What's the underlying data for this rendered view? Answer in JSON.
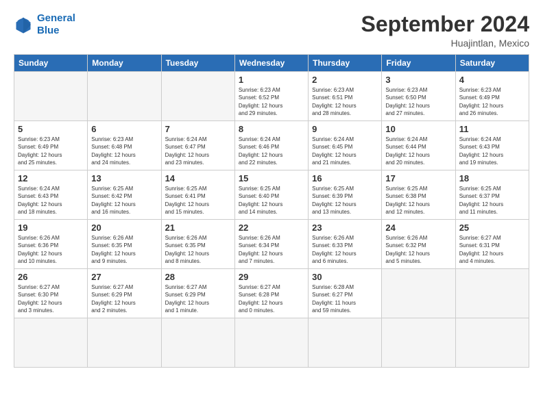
{
  "header": {
    "logo_line1": "General",
    "logo_line2": "Blue",
    "month": "September 2024",
    "location": "Huajintlan, Mexico"
  },
  "weekdays": [
    "Sunday",
    "Monday",
    "Tuesday",
    "Wednesday",
    "Thursday",
    "Friday",
    "Saturday"
  ],
  "days": [
    {
      "num": "",
      "info": ""
    },
    {
      "num": "",
      "info": ""
    },
    {
      "num": "",
      "info": ""
    },
    {
      "num": "1",
      "info": "Sunrise: 6:23 AM\nSunset: 6:52 PM\nDaylight: 12 hours\nand 29 minutes."
    },
    {
      "num": "2",
      "info": "Sunrise: 6:23 AM\nSunset: 6:51 PM\nDaylight: 12 hours\nand 28 minutes."
    },
    {
      "num": "3",
      "info": "Sunrise: 6:23 AM\nSunset: 6:50 PM\nDaylight: 12 hours\nand 27 minutes."
    },
    {
      "num": "4",
      "info": "Sunrise: 6:23 AM\nSunset: 6:49 PM\nDaylight: 12 hours\nand 26 minutes."
    },
    {
      "num": "5",
      "info": "Sunrise: 6:23 AM\nSunset: 6:49 PM\nDaylight: 12 hours\nand 25 minutes."
    },
    {
      "num": "6",
      "info": "Sunrise: 6:23 AM\nSunset: 6:48 PM\nDaylight: 12 hours\nand 24 minutes."
    },
    {
      "num": "7",
      "info": "Sunrise: 6:24 AM\nSunset: 6:47 PM\nDaylight: 12 hours\nand 23 minutes."
    },
    {
      "num": "8",
      "info": "Sunrise: 6:24 AM\nSunset: 6:46 PM\nDaylight: 12 hours\nand 22 minutes."
    },
    {
      "num": "9",
      "info": "Sunrise: 6:24 AM\nSunset: 6:45 PM\nDaylight: 12 hours\nand 21 minutes."
    },
    {
      "num": "10",
      "info": "Sunrise: 6:24 AM\nSunset: 6:44 PM\nDaylight: 12 hours\nand 20 minutes."
    },
    {
      "num": "11",
      "info": "Sunrise: 6:24 AM\nSunset: 6:43 PM\nDaylight: 12 hours\nand 19 minutes."
    },
    {
      "num": "12",
      "info": "Sunrise: 6:24 AM\nSunset: 6:43 PM\nDaylight: 12 hours\nand 18 minutes."
    },
    {
      "num": "13",
      "info": "Sunrise: 6:25 AM\nSunset: 6:42 PM\nDaylight: 12 hours\nand 16 minutes."
    },
    {
      "num": "14",
      "info": "Sunrise: 6:25 AM\nSunset: 6:41 PM\nDaylight: 12 hours\nand 15 minutes."
    },
    {
      "num": "15",
      "info": "Sunrise: 6:25 AM\nSunset: 6:40 PM\nDaylight: 12 hours\nand 14 minutes."
    },
    {
      "num": "16",
      "info": "Sunrise: 6:25 AM\nSunset: 6:39 PM\nDaylight: 12 hours\nand 13 minutes."
    },
    {
      "num": "17",
      "info": "Sunrise: 6:25 AM\nSunset: 6:38 PM\nDaylight: 12 hours\nand 12 minutes."
    },
    {
      "num": "18",
      "info": "Sunrise: 6:25 AM\nSunset: 6:37 PM\nDaylight: 12 hours\nand 11 minutes."
    },
    {
      "num": "19",
      "info": "Sunrise: 6:26 AM\nSunset: 6:36 PM\nDaylight: 12 hours\nand 10 minutes."
    },
    {
      "num": "20",
      "info": "Sunrise: 6:26 AM\nSunset: 6:35 PM\nDaylight: 12 hours\nand 9 minutes."
    },
    {
      "num": "21",
      "info": "Sunrise: 6:26 AM\nSunset: 6:35 PM\nDaylight: 12 hours\nand 8 minutes."
    },
    {
      "num": "22",
      "info": "Sunrise: 6:26 AM\nSunset: 6:34 PM\nDaylight: 12 hours\nand 7 minutes."
    },
    {
      "num": "23",
      "info": "Sunrise: 6:26 AM\nSunset: 6:33 PM\nDaylight: 12 hours\nand 6 minutes."
    },
    {
      "num": "24",
      "info": "Sunrise: 6:26 AM\nSunset: 6:32 PM\nDaylight: 12 hours\nand 5 minutes."
    },
    {
      "num": "25",
      "info": "Sunrise: 6:27 AM\nSunset: 6:31 PM\nDaylight: 12 hours\nand 4 minutes."
    },
    {
      "num": "26",
      "info": "Sunrise: 6:27 AM\nSunset: 6:30 PM\nDaylight: 12 hours\nand 3 minutes."
    },
    {
      "num": "27",
      "info": "Sunrise: 6:27 AM\nSunset: 6:29 PM\nDaylight: 12 hours\nand 2 minutes."
    },
    {
      "num": "28",
      "info": "Sunrise: 6:27 AM\nSunset: 6:29 PM\nDaylight: 12 hours\nand 1 minute."
    },
    {
      "num": "29",
      "info": "Sunrise: 6:27 AM\nSunset: 6:28 PM\nDaylight: 12 hours\nand 0 minutes."
    },
    {
      "num": "30",
      "info": "Sunrise: 6:28 AM\nSunset: 6:27 PM\nDaylight: 11 hours\nand 59 minutes."
    },
    {
      "num": "",
      "info": ""
    },
    {
      "num": "",
      "info": ""
    },
    {
      "num": "",
      "info": ""
    },
    {
      "num": "",
      "info": ""
    },
    {
      "num": "",
      "info": ""
    }
  ]
}
